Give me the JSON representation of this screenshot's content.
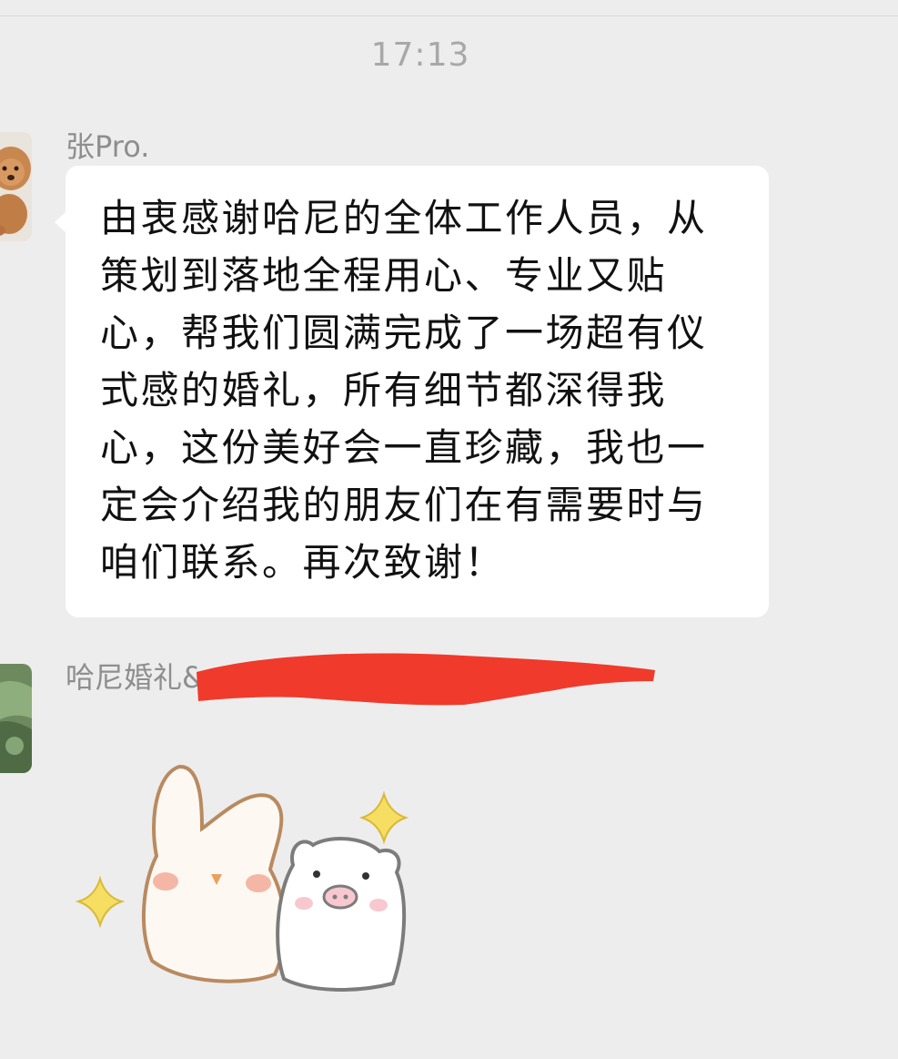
{
  "time_divider": "17:13",
  "messages": [
    {
      "sender": "张Pro.",
      "avatar_icon": "puppy-avatar-icon",
      "type": "text",
      "text": "由衷感谢哈尼的全体工作人员，从策划到落地全程用心、专业又贴心，帮我们圆满完成了一场超有仪式感的婚礼，所有细节都深得我心，这份美好会一直珍藏，我也一定会介绍我的朋友们在有需要时与咱们联系。再次致谢！"
    },
    {
      "sender": "哈尼婚礼&",
      "avatar_icon": "landscape-avatar-icon",
      "type": "sticker",
      "sticker_icon": "bunny-and-pig-sparkle-sticker-icon",
      "redaction_color": "#f03a2c"
    }
  ]
}
